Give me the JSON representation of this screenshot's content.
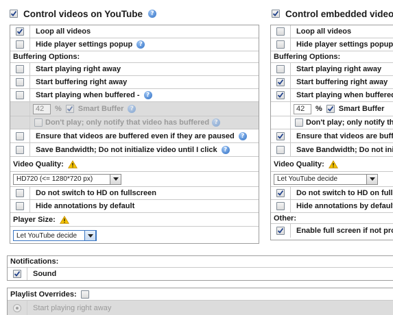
{
  "youtube": {
    "title": "Control videos on YouTube",
    "title_checked": true,
    "loop": "Loop all videos",
    "hide_popup": "Hide player settings popup",
    "buffering_header": "Buffering Options:",
    "start_playing": "Start playing right away",
    "start_buffering": "Start buffering right away",
    "start_when_buffered": "Start playing when buffered -",
    "buffer_value": "42",
    "percent": "%",
    "smart_buffer": "Smart Buffer",
    "dont_play": "Don't play; only notify that video has buffered",
    "ensure_buffered": "Ensure that videos are buffered even if they are paused",
    "save_bandwidth": "Save Bandwidth; Do not initialize video until I click",
    "quality_header": "Video Quality:",
    "quality_value": "HD720 (<= 1280*720 px)",
    "no_hd_fullscreen": "Do not switch to HD on fullscreen",
    "hide_annotations": "Hide annotations by default",
    "player_size_header": "Player Size:",
    "player_size_value": "Let YouTube decide"
  },
  "embedded": {
    "title": "Control embedded videos",
    "title_checked": true,
    "loop": "Loop all videos",
    "hide_popup": "Hide player settings popup",
    "buffering_header": "Buffering Options:",
    "start_playing": "Start playing right away",
    "start_buffering": "Start buffering right away",
    "start_when_buffered": "Start playing when buffered -",
    "buffer_value": "42",
    "percent": "%",
    "smart_buffer": "Smart Buffer",
    "dont_play": "Don't play; only notify that video has buffered",
    "ensure_buffered": "Ensure that videos are buffered even if they are paused",
    "save_bandwidth": "Save Bandwidth; Do not initialize video until I click",
    "quality_header": "Video Quality:",
    "quality_value": "Let YouTube decide",
    "no_hd_fullscreen": "Do not switch to HD on fullscreen",
    "hide_annotations": "Hide annotations by default",
    "other_header": "Other:",
    "enable_fullscreen": "Enable full screen if not provided"
  },
  "notifications": {
    "header": "Notifications:",
    "sound": "Sound"
  },
  "playlist": {
    "header": "Playlist Overrides:",
    "start_playing": "Start playing right away"
  },
  "colors": {
    "info": "#2f6fc4",
    "warning": "#f2c200",
    "disabled_row": "#dcdcdc",
    "border": "#9d9d9d"
  },
  "icons": {
    "info": "info-icon",
    "warning": "warning-icon",
    "check": "checkmark-icon",
    "dropdown": "chevron-down-icon"
  }
}
